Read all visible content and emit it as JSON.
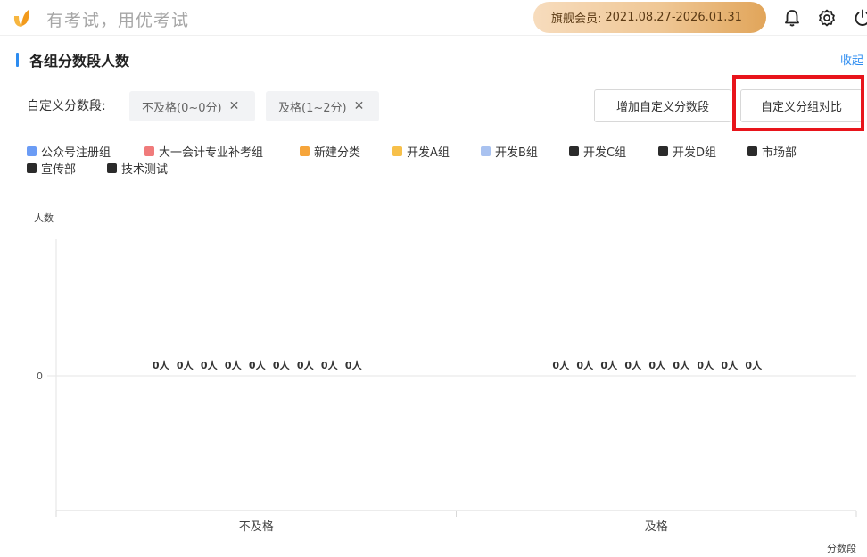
{
  "header": {
    "slogan": "有考试，用优考试",
    "vip_label": "旗舰会员:",
    "vip_period": "2021.08.27-2026.01.31",
    "icons": [
      "logo-icon",
      "bell-icon",
      "gear-icon",
      "power-icon"
    ]
  },
  "section": {
    "title": "各组分数段人数",
    "collapse_label": "收起"
  },
  "ranges": {
    "label": "自定义分数段:",
    "items": [
      {
        "text": "不及格(0~0分)"
      },
      {
        "text": "及格(1~2分)"
      }
    ]
  },
  "buttons": {
    "add_range": "增加自定义分数段",
    "compare": "自定义分组对比"
  },
  "colors": {
    "accent": "#2d8cf0",
    "highlight": "#e8141b"
  },
  "chart_data": {
    "type": "bar",
    "ylabel": "人数",
    "xlabel": "分数段",
    "categories": [
      "不及格",
      "及格"
    ],
    "y_ticks": [
      "0"
    ],
    "series": [
      {
        "name": "公众号注册组",
        "color": "#6b9cf5",
        "values": [
          0,
          0
        ],
        "labels": [
          "0人",
          "0人"
        ]
      },
      {
        "name": "大一会计专业补考组",
        "color": "#f07b7b",
        "values": [
          0,
          0
        ],
        "labels": [
          "0人",
          "0人"
        ]
      },
      {
        "name": "新建分类",
        "color": "#f6a53b",
        "values": [
          0,
          0
        ],
        "labels": [
          "0人",
          "0人"
        ]
      },
      {
        "name": "开发A组",
        "color": "#f7c04a",
        "values": [
          0,
          0
        ],
        "labels": [
          "0人",
          "0人"
        ]
      },
      {
        "name": "开发B组",
        "color": "#a9c2f0",
        "values": [
          0,
          0
        ],
        "labels": [
          "0人",
          "0人"
        ]
      },
      {
        "name": "开发C组",
        "color": "#2b2b2b",
        "values": [
          0,
          0
        ],
        "labels": [
          "0人",
          "0人"
        ]
      },
      {
        "name": "开发D组",
        "color": "#2b2b2b",
        "values": [
          0,
          0
        ],
        "labels": [
          "0人",
          "0人"
        ]
      },
      {
        "name": "市场部",
        "color": "#2b2b2b",
        "values": [
          0,
          0
        ],
        "labels": [
          "0人",
          "0人"
        ]
      },
      {
        "name": "宣传部",
        "color": "#2b2b2b",
        "values": [
          0,
          0
        ],
        "labels": [
          "0人",
          "0人"
        ]
      },
      {
        "name": "技术测试",
        "color": "#2b2b2b",
        "values": [
          0,
          0
        ],
        "labels": [
          "0人",
          "0人"
        ]
      }
    ],
    "legend_position": "top-left",
    "grid": false
  }
}
